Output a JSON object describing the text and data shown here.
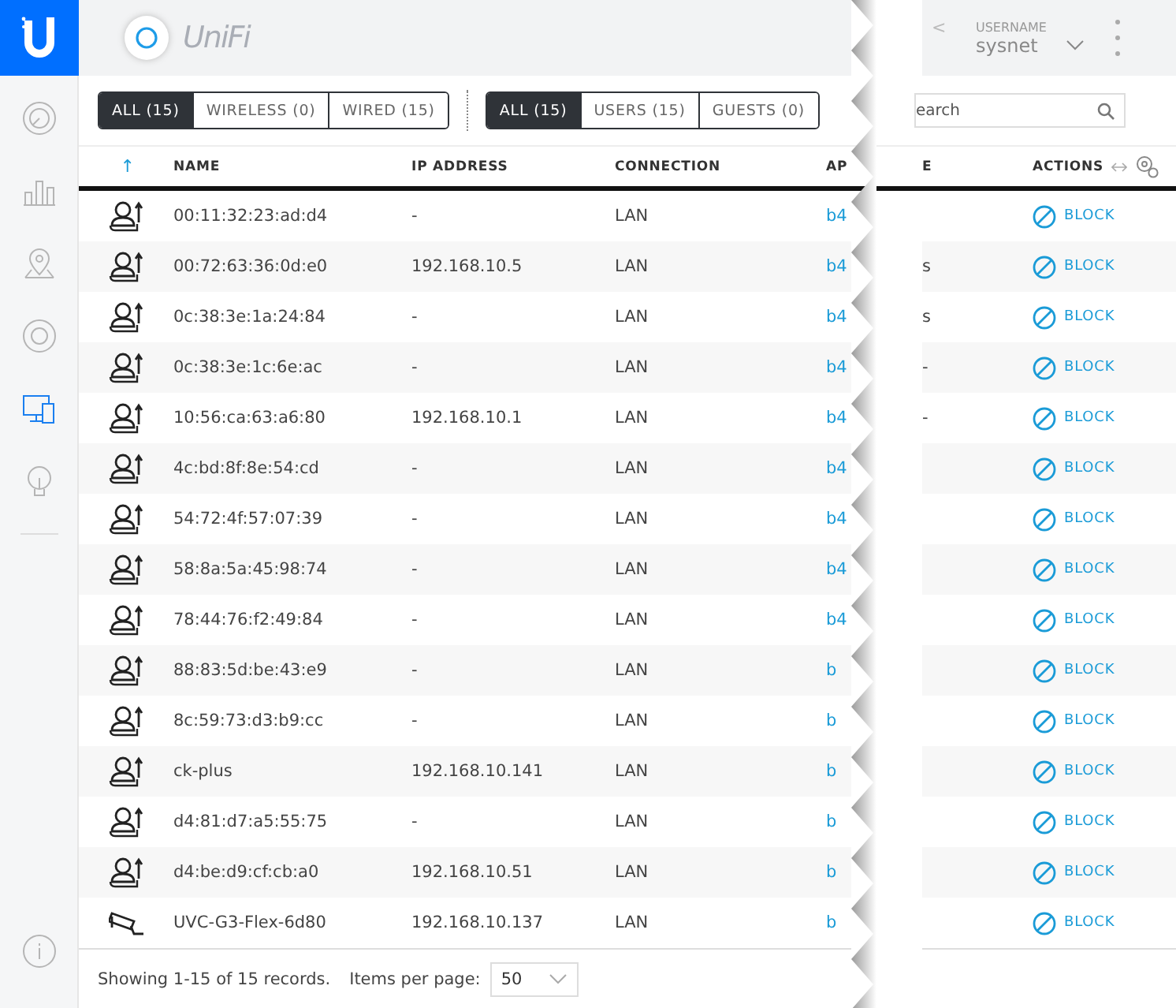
{
  "sidebar": {
    "items": [
      {
        "kind": "dashboard",
        "selected": false
      },
      {
        "kind": "stats",
        "selected": false
      },
      {
        "kind": "map",
        "selected": false
      },
      {
        "kind": "devices",
        "selected": false
      },
      {
        "kind": "clients",
        "selected": true
      },
      {
        "kind": "insights",
        "selected": false
      }
    ],
    "bottom_items": [
      {
        "kind": "info",
        "selected": false
      }
    ]
  },
  "header": {
    "brand": "UniFi",
    "back_glyph": "<",
    "username_label": "USERNAME",
    "username": "sysnet"
  },
  "filters": [
    [
      {
        "label": "ALL (15)",
        "selected": true
      },
      {
        "label": "WIRELESS (0)",
        "selected": false
      },
      {
        "label": "WIRED (15)",
        "selected": false
      }
    ],
    [
      {
        "label": "ALL (15)",
        "selected": true
      },
      {
        "label": "USERS (15)",
        "selected": false
      },
      {
        "label": "GUESTS (0)",
        "selected": false
      }
    ]
  ],
  "search": {
    "placeholder": "earch"
  },
  "table": {
    "columns": [
      "↑",
      "NAME",
      "IP ADDRESS",
      "CONNECTION",
      "AP",
      "E",
      "ACTIONS"
    ],
    "rows": [
      {
        "kind": "user",
        "name": "00:11:32:23:ad:d4",
        "ip": "-",
        "connection": "LAN",
        "ap": "b4",
        "column_6": "",
        "action": "BLOCK"
      },
      {
        "kind": "user",
        "name": "00:72:63:36:0d:e0",
        "ip": "192.168.10.5",
        "connection": "LAN",
        "ap": "b4",
        "column_6": "s",
        "action": "BLOCK"
      },
      {
        "kind": "user",
        "name": "0c:38:3e:1a:24:84",
        "ip": "-",
        "connection": "LAN",
        "ap": "b4",
        "column_6": "s",
        "action": "BLOCK"
      },
      {
        "kind": "user",
        "name": "0c:38:3e:1c:6e:ac",
        "ip": "-",
        "connection": "LAN",
        "ap": "b4",
        "column_6": "-",
        "action": "BLOCK"
      },
      {
        "kind": "user",
        "name": "10:56:ca:63:a6:80",
        "ip": "192.168.10.1",
        "connection": "LAN",
        "ap": "b4",
        "column_6": "-",
        "action": "BLOCK"
      },
      {
        "kind": "user",
        "name": "4c:bd:8f:8e:54:cd",
        "ip": "-",
        "connection": "LAN",
        "ap": "b4",
        "column_6": "",
        "action": "BLOCK"
      },
      {
        "kind": "user",
        "name": "54:72:4f:57:07:39",
        "ip": "-",
        "connection": "LAN",
        "ap": "b4",
        "column_6": "",
        "action": "BLOCK"
      },
      {
        "kind": "user",
        "name": "58:8a:5a:45:98:74",
        "ip": "-",
        "connection": "LAN",
        "ap": "b4",
        "column_6": "",
        "action": "BLOCK"
      },
      {
        "kind": "user",
        "name": "78:44:76:f2:49:84",
        "ip": "-",
        "connection": "LAN",
        "ap": "b4",
        "column_6": "",
        "action": "BLOCK"
      },
      {
        "kind": "user",
        "name": "88:83:5d:be:43:e9",
        "ip": "-",
        "connection": "LAN",
        "ap": "b",
        "column_6": "",
        "action": "BLOCK"
      },
      {
        "kind": "user",
        "name": "8c:59:73:d3:b9:cc",
        "ip": "-",
        "connection": "LAN",
        "ap": "b",
        "column_6": "",
        "action": "BLOCK"
      },
      {
        "kind": "user",
        "name": "ck-plus",
        "ip": "192.168.10.141",
        "connection": "LAN",
        "ap": "b",
        "column_6": "",
        "action": "BLOCK"
      },
      {
        "kind": "user",
        "name": "d4:81:d7:a5:55:75",
        "ip": "-",
        "connection": "LAN",
        "ap": "b",
        "column_6": "",
        "action": "BLOCK"
      },
      {
        "kind": "user",
        "name": "d4:be:d9:cf:cb:a0",
        "ip": "192.168.10.51",
        "connection": "LAN",
        "ap": "b",
        "column_6": "",
        "action": "BLOCK"
      },
      {
        "kind": "camera",
        "name": "UVC-G3-Flex-6d80",
        "ip": "192.168.10.137",
        "connection": "LAN",
        "ap": "b",
        "column_6": "",
        "action": "BLOCK"
      }
    ]
  },
  "footer": {
    "summary": "Showing 1-15 of 15 records.",
    "items_label": "Items per page:",
    "per_page": "50"
  }
}
